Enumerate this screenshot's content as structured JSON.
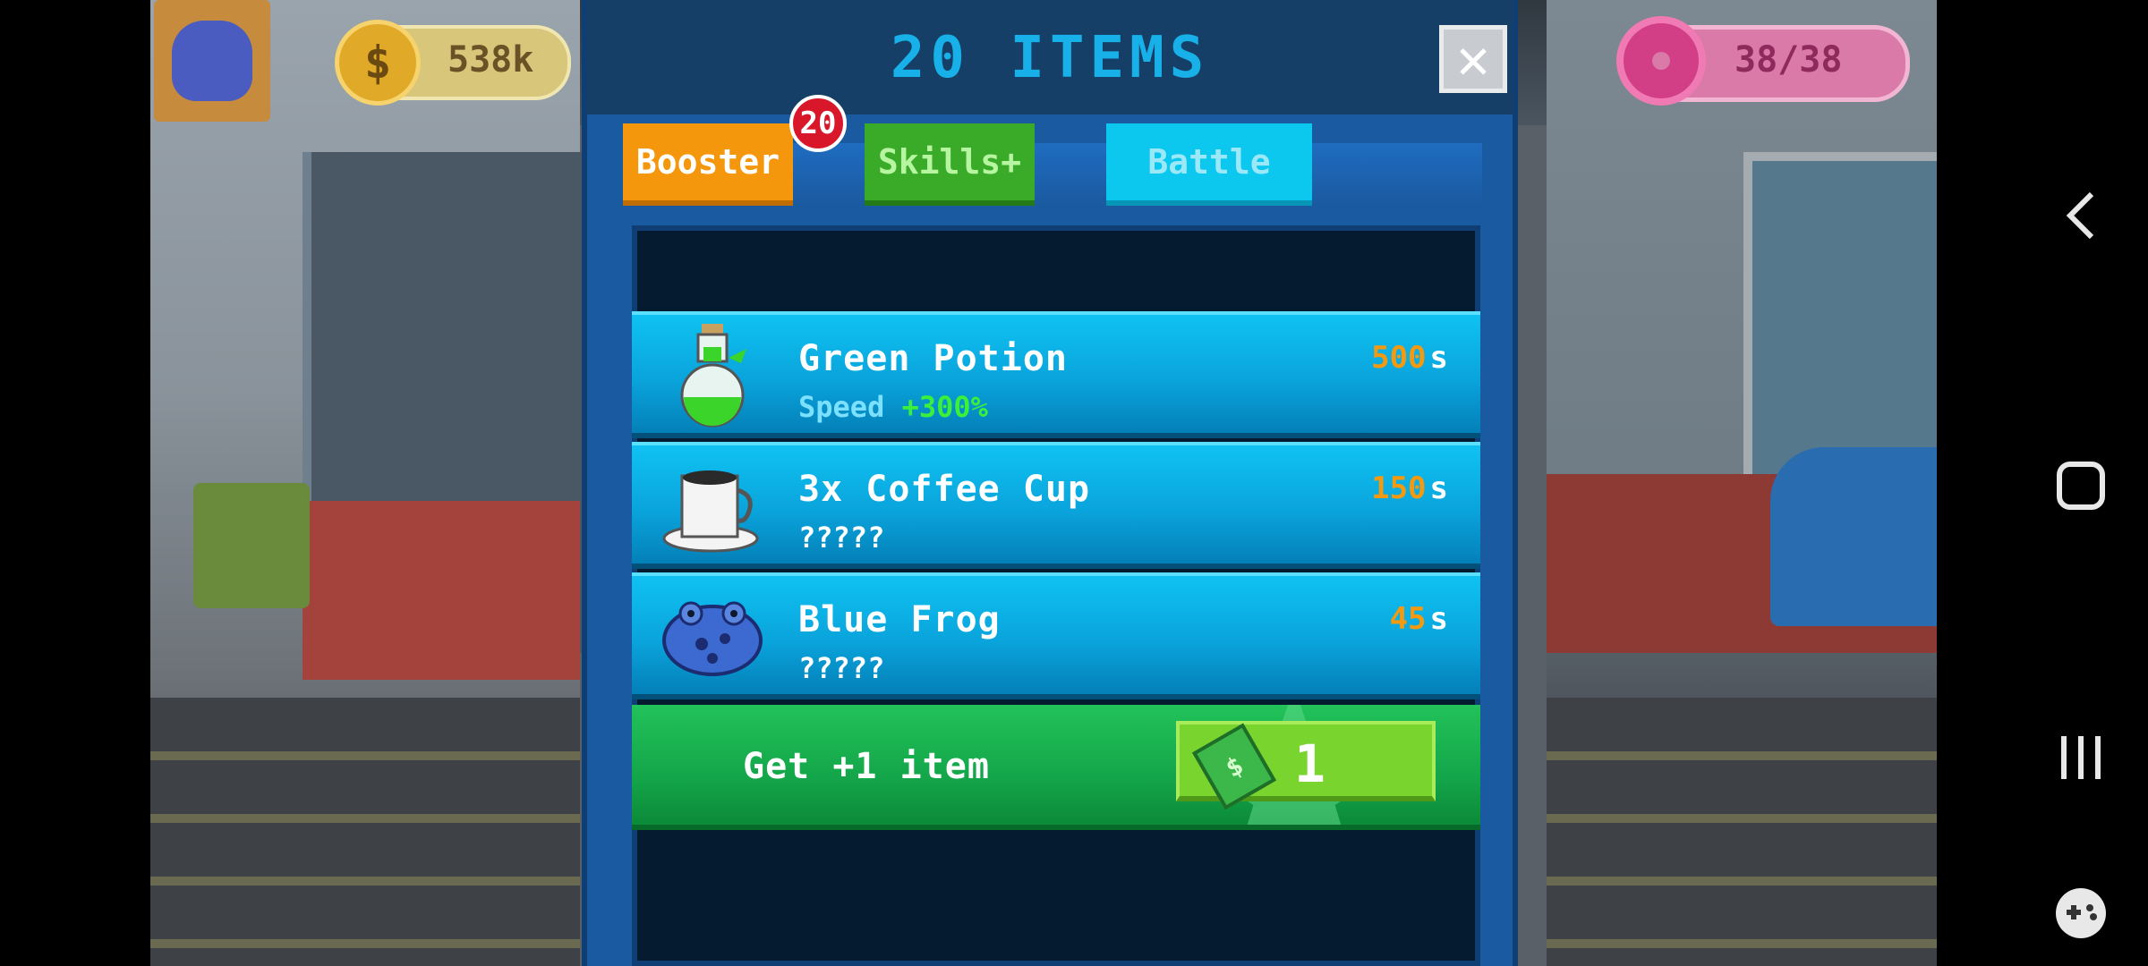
{
  "hud": {
    "coins": "538k",
    "donuts": "38/38"
  },
  "dialog": {
    "title": "20 ITEMS",
    "close": "✕",
    "tabs": [
      {
        "label": "Booster"
      },
      {
        "label": "Skills+"
      },
      {
        "label": "Battle"
      }
    ],
    "badge": "20",
    "items": [
      {
        "name": "Green Potion",
        "desc_prefix": "Speed",
        "desc_value": "+300%",
        "time": "500",
        "unit": "s"
      },
      {
        "name": "3x Coffee Cup",
        "desc": "?????",
        "time": "150",
        "unit": "s"
      },
      {
        "name": "Blue Frog",
        "desc": "?????",
        "time": "45",
        "unit": "s"
      }
    ],
    "get_item": {
      "label": "Get +1 item",
      "cost": "1"
    }
  },
  "icons": {
    "coin": "$",
    "cash": "$"
  },
  "colors": {
    "booster_tab": "#f5970d",
    "skills_tab": "#3aab28",
    "battle_tab": "#0cc8ee",
    "title": "#18b0e8",
    "time": "#f59a10"
  }
}
